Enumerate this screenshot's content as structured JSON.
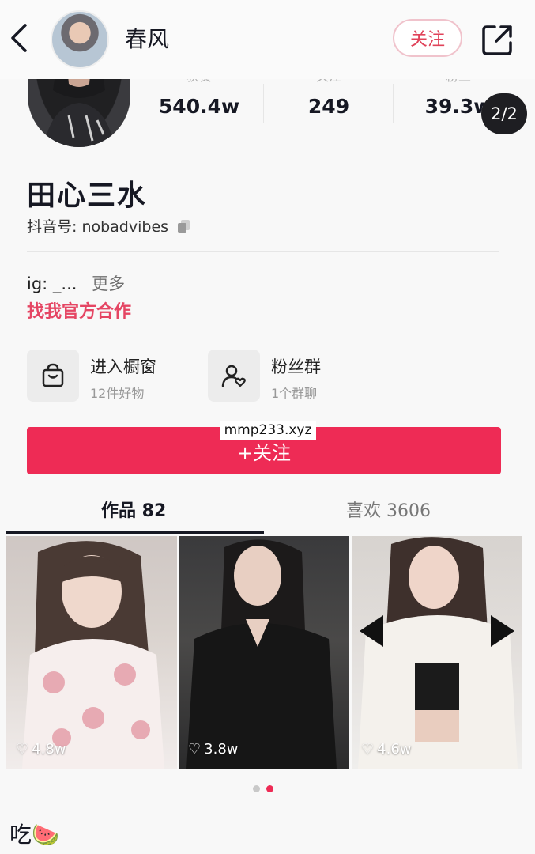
{
  "header": {
    "back_icon": "back-arrow-icon",
    "name": "春风",
    "follow_label": "关注",
    "share_icon": "share-icon"
  },
  "stats": [
    {
      "label": "获赞",
      "value": "540.4w"
    },
    {
      "label": "关注",
      "value": "249"
    },
    {
      "label": "粉丝",
      "value": "39.3w"
    }
  ],
  "page_indicator": "2/2",
  "profile": {
    "nickname": "田心三水",
    "account": "抖音号: nobadvibes",
    "bio": "ig: _...",
    "more_label": "更多",
    "cooperate": "找我官方合作"
  },
  "entries": [
    {
      "title": "进入橱窗",
      "subtitle": "12件好物",
      "icon": "shopping-bag-icon"
    },
    {
      "title": "粉丝群",
      "subtitle": "1个群聊",
      "icon": "fan-group-icon"
    }
  ],
  "follow_button": "+关注",
  "watermark": "mmp233.xyz",
  "tabs": [
    {
      "label": "作品 82",
      "active": true
    },
    {
      "label": "喜欢 3606",
      "active": false
    }
  ],
  "videos": [
    {
      "likes": "4.8w"
    },
    {
      "likes": "3.8w"
    },
    {
      "likes": "4.6w"
    }
  ],
  "caption": "吃🍉",
  "colors": {
    "accent": "#ee2b55",
    "link": "#e54563"
  }
}
